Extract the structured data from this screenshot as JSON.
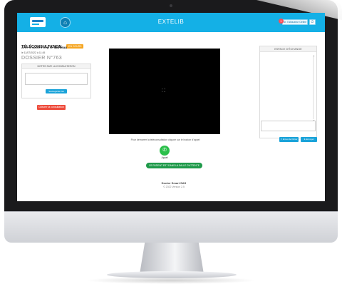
{
  "header": {
    "app_title": "EXTELIB",
    "notification_count": "1",
    "user_label": "Dr. l'Allouzeur Céline",
    "home_icon": "home-icon",
    "logout_icon": "power-icon"
  },
  "consultation": {
    "title": "TÉLÉCONSULTATION",
    "status_badge": "EN COURS",
    "patient_prefix": "avec le patient Sophie",
    "patient_surname": "Marceau",
    "date_label": "le 11/07/2022 à 11:45",
    "dossier": "DOSSIER N°763"
  },
  "notes": {
    "header": "NOTES SUR LA CONSULTATION",
    "save_button": "Sauvegarder les notes"
  },
  "end_button": "Clôturer la consultation",
  "video": {
    "placeholder_icon": "camera-off-icon",
    "hint": "Pour démarrer la téléconsultation cliquez sur le bouton d'appel",
    "call_label": "Appel",
    "waiting_room_button": "CE PATIENT EST DANS LA SALLE D'ATTENTE"
  },
  "footer": {
    "company": "Doctor Smart SAS",
    "version": "© 2022 Version 2.5"
  },
  "exchange": {
    "header": "ESPACE D'ÉCHANGE",
    "send_file_button": "Envoi de fichier",
    "send_button": "Envoyer"
  },
  "colors": {
    "topbar": "#14b0e6",
    "primary_button": "#1aa3d9",
    "danger_button": "#ee4b3b",
    "success_button": "#1f9a4a",
    "call_button": "#2bbf4a",
    "badge": "#f5a623"
  }
}
